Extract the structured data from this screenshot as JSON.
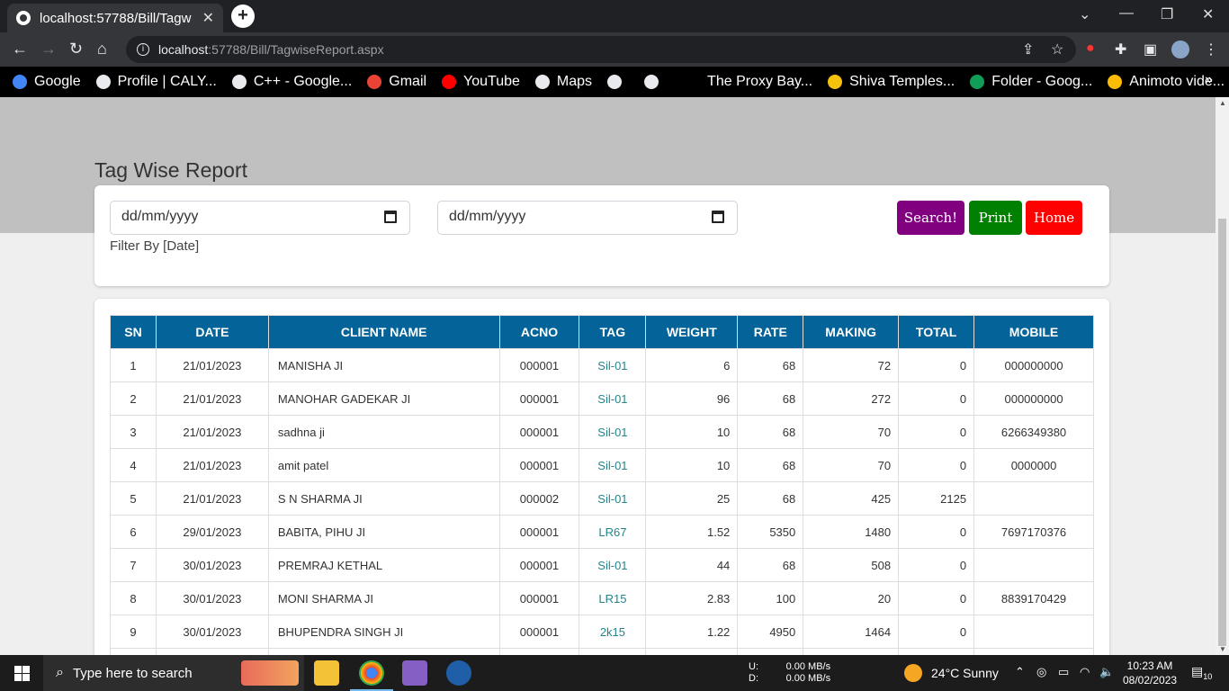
{
  "browser": {
    "tab_title": "localhost:57788/Bill/Tagw",
    "tab_close": "✕",
    "new_tab": "+",
    "url_host": "localhost",
    "url_path": ":57788/Bill/TagwiseReport.aspx"
  },
  "bookmarks": [
    {
      "label": "Google",
      "color": "#4285f4"
    },
    {
      "label": "Profile | CALY...",
      "color": "#e8eaed"
    },
    {
      "label": "C++ - Google...",
      "color": "#e8eaed"
    },
    {
      "label": "Gmail",
      "color": "#ea4335"
    },
    {
      "label": "YouTube",
      "color": "#ff0000"
    },
    {
      "label": "Maps",
      "color": "#e8eaed"
    },
    {
      "label": "",
      "color": "#e8eaed"
    },
    {
      "label": "",
      "color": "#e8eaed"
    },
    {
      "label": "The Proxy Bay...",
      "color": "#000000"
    },
    {
      "label": "Shiva Temples...",
      "color": "#f4c20d"
    },
    {
      "label": "Folder - Goog...",
      "color": "#0f9d58"
    },
    {
      "label": "Animoto vide...",
      "color": "#fbbc05"
    }
  ],
  "page": {
    "title": "Tag Wise Report",
    "date_from_placeholder": "dd/mm/yyyy",
    "date_to_placeholder": "dd/mm/yyyy",
    "filter_label": "Filter By [Date]",
    "search_label": "Search!",
    "print_label": "Print",
    "home_label": "Home",
    "colors": {
      "search": "#800080",
      "print": "#008000",
      "home": "#ff0000",
      "header": "#046499"
    }
  },
  "table": {
    "headers": [
      "SN",
      "DATE",
      "CLIENT NAME",
      "ACNO",
      "TAG",
      "WEIGHT",
      "RATE",
      "MAKING",
      "TOTAL",
      "MOBILE"
    ],
    "rows": [
      [
        "1",
        "21/01/2023",
        "MANISHA JI",
        "000001",
        "Sil-01",
        "6",
        "68",
        "72",
        "0",
        "000000000"
      ],
      [
        "2",
        "21/01/2023",
        "MANOHAR GADEKAR JI",
        "000001",
        "Sil-01",
        "96",
        "68",
        "272",
        "0",
        "000000000"
      ],
      [
        "3",
        "21/01/2023",
        "sadhna ji",
        "000001",
        "Sil-01",
        "10",
        "68",
        "70",
        "0",
        "6266349380"
      ],
      [
        "4",
        "21/01/2023",
        "amit patel",
        "000001",
        "Sil-01",
        "10",
        "68",
        "70",
        "0",
        "0000000"
      ],
      [
        "5",
        "21/01/2023",
        "S N SHARMA JI",
        "000002",
        "Sil-01",
        "25",
        "68",
        "425",
        "2125",
        ""
      ],
      [
        "6",
        "29/01/2023",
        "BABITA, PIHU JI",
        "000001",
        "LR67",
        "1.52",
        "5350",
        "1480",
        "0",
        "7697170376"
      ],
      [
        "7",
        "30/01/2023",
        "PREMRAJ KETHAL",
        "000001",
        "Sil-01",
        "44",
        "68",
        "508",
        "0",
        ""
      ],
      [
        "8",
        "30/01/2023",
        "MONI SHARMA JI",
        "000001",
        "LR15",
        "2.83",
        "100",
        "20",
        "0",
        "8839170429"
      ],
      [
        "9",
        "30/01/2023",
        "BHUPENDRA SINGH JI",
        "000001",
        "2k15",
        "1.22",
        "4950",
        "1464",
        "0",
        ""
      ]
    ]
  },
  "taskbar": {
    "search_placeholder": "Type here to search",
    "net_up": "U:",
    "net_down": "D:",
    "net_up_val": "0.00 MB/s",
    "net_down_val": "0.00 MB/s",
    "weather": "24°C  Sunny",
    "time": "10:23 AM",
    "date": "08/02/2023",
    "notif_count": "10"
  }
}
